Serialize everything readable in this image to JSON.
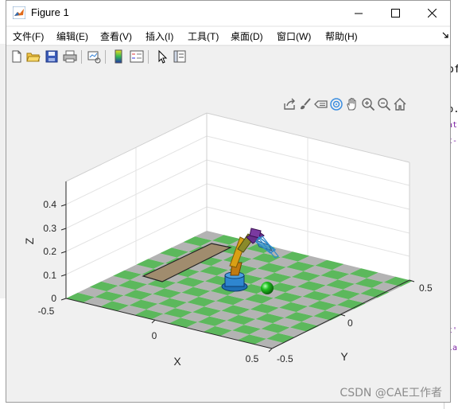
{
  "window": {
    "title": "Figure 1"
  },
  "menu": [
    {
      "label": "文件(F)"
    },
    {
      "label": "编辑(E)"
    },
    {
      "label": "查看(V)"
    },
    {
      "label": "插入(I)"
    },
    {
      "label": "工具(T)"
    },
    {
      "label": "桌面(D)"
    },
    {
      "label": "窗口(W)"
    },
    {
      "label": "帮助(H)"
    }
  ],
  "toolbar_icons": [
    "new-figure-icon",
    "open-file-icon",
    "save-icon",
    "print-icon",
    "link-plot-icon",
    "colorbar-icon",
    "legend-icon",
    "edit-plot-icon",
    "property-inspector-icon"
  ],
  "axes_toolbar_icons": [
    "export-icon",
    "brush-icon",
    "data-tips-icon",
    "rotate-3d-icon",
    "pan-icon",
    "zoom-in-icon",
    "zoom-out-icon",
    "home-icon"
  ],
  "axes": {
    "z_label": "Z",
    "x_label": "X",
    "y_label": "Y",
    "z_ticks": [
      "0",
      "0.1",
      "0.2",
      "0.3",
      "0.4"
    ],
    "x_ticks": [
      "-0.5",
      "0",
      "0.5"
    ],
    "y_ticks": [
      "-0.5",
      "0",
      "0.5"
    ]
  },
  "scene": {
    "floor_colors": [
      "#5cb85c",
      "#b3b3b3"
    ],
    "floor_tiles": 12,
    "objects": [
      "checkered-floor",
      "table-box",
      "robot-arm",
      "green-ball"
    ]
  },
  "watermark": "CSDN @CAE工作者",
  "background_fragments": [
    "of",
    "o.",
    "at",
    "t-",
    "t'",
    "la"
  ]
}
